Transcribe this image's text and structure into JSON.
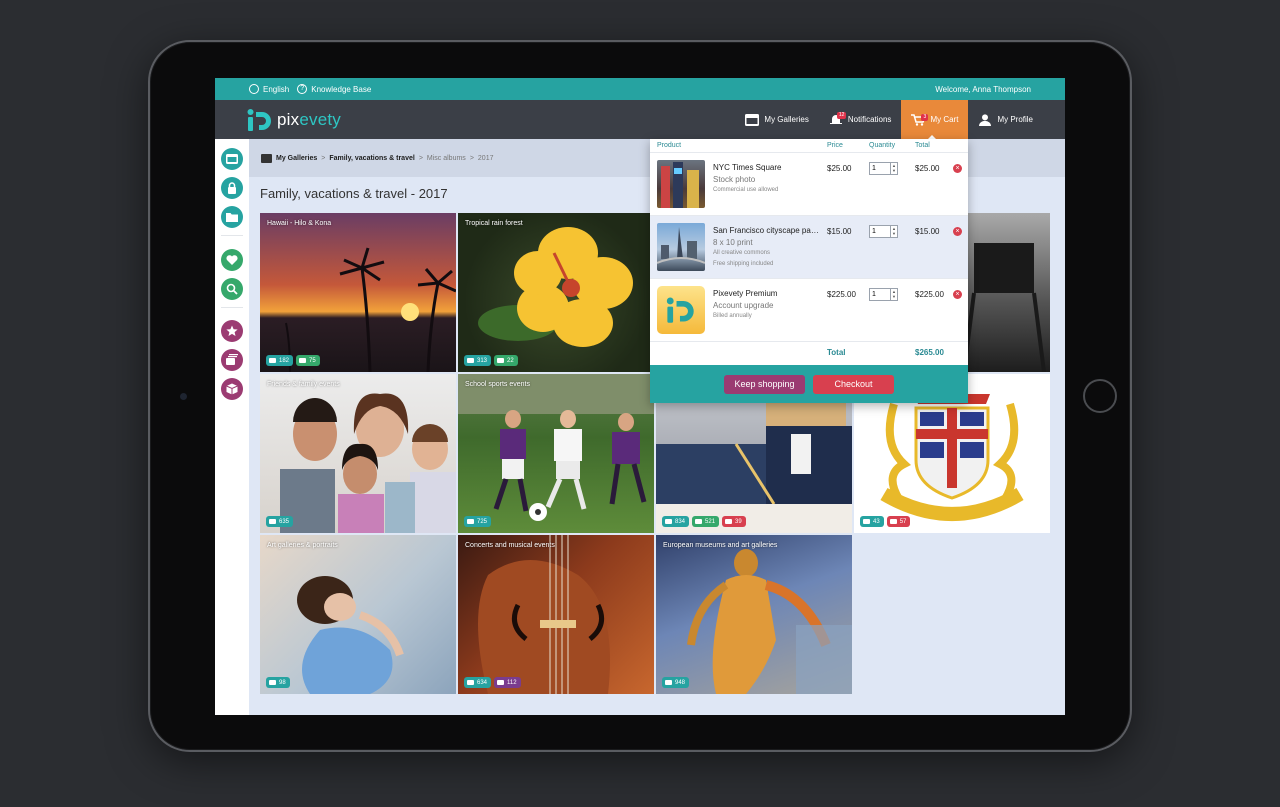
{
  "topbar": {
    "language": "English",
    "knowledge_base": "Knowledge Base",
    "welcome": "Welcome,  Anna Thompson"
  },
  "header": {
    "logo_pix": "pix",
    "logo_evety": "evety",
    "nav": [
      {
        "label": "My Galleries",
        "icon": "gallery-icon"
      },
      {
        "label": "Notifications",
        "icon": "bell-icon",
        "badge": "12"
      },
      {
        "label": "My Cart",
        "icon": "cart-icon",
        "badge": "3"
      },
      {
        "label": "My Profile",
        "icon": "user-icon"
      }
    ]
  },
  "breadcrumb": {
    "root": "My Galleries",
    "level1": "Family, vacations & travel",
    "level2": "Misc albums",
    "level3": "2017"
  },
  "page_title": "Family, vacations & travel - 2017",
  "tiles": [
    {
      "label": "Hawaii - Hilo & Kona",
      "chips": [
        {
          "type": "photos",
          "value": "182"
        },
        {
          "type": "videos",
          "value": "75"
        }
      ]
    },
    {
      "label": "Tropical rain forest",
      "chips": [
        {
          "type": "photos",
          "value": "313"
        },
        {
          "type": "videos",
          "value": "22"
        }
      ]
    },
    {
      "label": "Friends & family events",
      "chips": [
        {
          "type": "photos",
          "value": "635"
        }
      ]
    },
    {
      "label": "School sports events",
      "chips": [
        {
          "type": "photos",
          "value": "725"
        }
      ]
    },
    {
      "label": "",
      "chips": [
        {
          "type": "photos",
          "value": "834"
        },
        {
          "type": "videos",
          "value": "521"
        },
        {
          "type": "docs",
          "value": "39"
        }
      ]
    },
    {
      "label": "",
      "chips": [
        {
          "type": "photos",
          "value": "43"
        },
        {
          "type": "docs",
          "value": "57"
        }
      ]
    },
    {
      "label": "Art galleries & portraits",
      "chips": [
        {
          "type": "photos",
          "value": "98"
        }
      ]
    },
    {
      "label": "Concerts and musical events",
      "chips": [
        {
          "type": "photos",
          "value": "634"
        },
        {
          "type": "audio",
          "value": "112"
        }
      ]
    },
    {
      "label": "European museums and art galleries",
      "chips": [
        {
          "type": "photos",
          "value": "948"
        }
      ]
    }
  ],
  "cart": {
    "headers": {
      "product": "Product",
      "price": "Price",
      "quantity": "Quantity",
      "total": "Total"
    },
    "items": [
      {
        "name": "NYC Times Square",
        "sub": "Stock photo",
        "notes": [
          "Commercial use allowed"
        ],
        "price": "$25.00",
        "qty": "1",
        "total": "$25.00"
      },
      {
        "name": "San Francisco cityscape panorama",
        "sub": "8 x 10 print",
        "notes": [
          "All creative commons",
          "Free shipping included"
        ],
        "price": "$15.00",
        "qty": "1",
        "total": "$15.00"
      },
      {
        "name": "Pixevety Premium",
        "sub": "Account upgrade",
        "notes": [
          "Billed annually"
        ],
        "price": "$225.00",
        "qty": "1",
        "total": "$225.00"
      }
    ],
    "total_label": "Total",
    "total_value": "$265.00",
    "keep_shopping": "Keep shopping",
    "checkout": "Checkout"
  },
  "colors": {
    "teal": "#26a3a1",
    "header": "#3b3f47",
    "orange": "#e9893a",
    "purple": "#9b3b72",
    "red": "#d8404f"
  }
}
